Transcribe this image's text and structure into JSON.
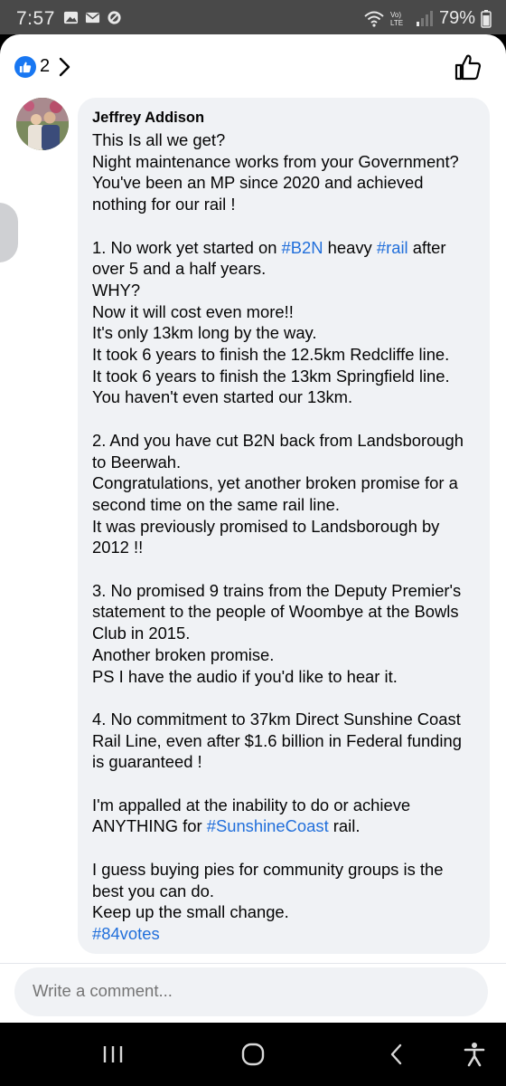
{
  "status_bar": {
    "time": "7:57",
    "battery": "79%",
    "left_icons": [
      "gallery-icon",
      "mail-icon",
      "block-icon"
    ],
    "right_icons": [
      "wifi-icon",
      "volte-icon",
      "signal-icon"
    ],
    "volte_label": "Vo) LTE"
  },
  "header": {
    "like_count": "2",
    "accent": "#1877f2"
  },
  "comment": {
    "author": "Jeffrey Addison",
    "hashtag_color": "#216fdb",
    "lines": [
      {
        "segments": [
          {
            "text": "This Is all we get?"
          }
        ]
      },
      {
        "segments": [
          {
            "text": "Night maintenance works from your Government?"
          }
        ]
      },
      {
        "segments": [
          {
            "text": "You've been an MP since 2020 and achieved"
          }
        ]
      },
      {
        "segments": [
          {
            "text": "nothing for our rail !"
          }
        ]
      },
      {
        "segments": []
      },
      {
        "segments": [
          {
            "text": "1. No work yet started on "
          },
          {
            "text": "#B2N",
            "tag": true
          },
          {
            "text": " heavy "
          },
          {
            "text": "#rail",
            "tag": true
          },
          {
            "text": " after"
          }
        ]
      },
      {
        "segments": [
          {
            "text": "over 5 and a half years."
          }
        ]
      },
      {
        "segments": [
          {
            "text": "WHY?"
          }
        ]
      },
      {
        "segments": [
          {
            "text": "Now it will cost even more!!"
          }
        ]
      },
      {
        "segments": [
          {
            "text": "It's only 13km long by the way."
          }
        ]
      },
      {
        "segments": [
          {
            "text": "It took 6 years to finish the 12.5km Redcliffe line."
          }
        ]
      },
      {
        "segments": [
          {
            "text": "It took 6 years to finish the 13km Springfield line."
          }
        ]
      },
      {
        "segments": [
          {
            "text": "You haven't even started our 13km."
          }
        ]
      },
      {
        "segments": []
      },
      {
        "segments": [
          {
            "text": "2. And you have cut B2N back from Landsborough"
          }
        ]
      },
      {
        "segments": [
          {
            "text": "to Beerwah."
          }
        ]
      },
      {
        "segments": [
          {
            "text": "Congratulations, yet another broken promise for a"
          }
        ]
      },
      {
        "segments": [
          {
            "text": "second time on the same rail line."
          }
        ]
      },
      {
        "segments": [
          {
            "text": "It was previously promised to Landsborough by"
          }
        ]
      },
      {
        "segments": [
          {
            "text": "2012 !!"
          }
        ]
      },
      {
        "segments": []
      },
      {
        "segments": [
          {
            "text": "3. No promised 9 trains from the Deputy Premier's"
          }
        ]
      },
      {
        "segments": [
          {
            "text": "statement to the people of Woombye at the Bowls"
          }
        ]
      },
      {
        "segments": [
          {
            "text": "Club in 2015."
          }
        ]
      },
      {
        "segments": [
          {
            "text": "Another broken promise."
          }
        ]
      },
      {
        "segments": [
          {
            "text": "PS I have the audio if you'd like to hear it."
          }
        ]
      },
      {
        "segments": []
      },
      {
        "segments": [
          {
            "text": "4. No commitment to 37km Direct Sunshine Coast"
          }
        ]
      },
      {
        "segments": [
          {
            "text": "Rail Line, even after $1.6 billion in Federal funding"
          }
        ]
      },
      {
        "segments": [
          {
            "text": "is guaranteed !"
          }
        ]
      },
      {
        "segments": []
      },
      {
        "segments": [
          {
            "text": "I'm appalled at the inability to do or achieve"
          }
        ]
      },
      {
        "segments": [
          {
            "text": "ANYTHING for "
          },
          {
            "text": "#SunshineCoast",
            "tag": true
          },
          {
            "text": " rail."
          }
        ]
      },
      {
        "segments": []
      },
      {
        "segments": [
          {
            "text": "I guess buying pies for community groups is the"
          }
        ]
      },
      {
        "segments": [
          {
            "text": "best you can do."
          }
        ]
      },
      {
        "segments": [
          {
            "text": "Keep up the small change."
          }
        ]
      },
      {
        "segments": [
          {
            "text": "#84votes",
            "tag": true
          }
        ]
      }
    ]
  },
  "composer": {
    "placeholder": "Write a comment..."
  },
  "nav_bar": {
    "buttons": [
      "recent-apps-icon",
      "home-icon",
      "back-icon",
      "accessibility-icon"
    ]
  }
}
